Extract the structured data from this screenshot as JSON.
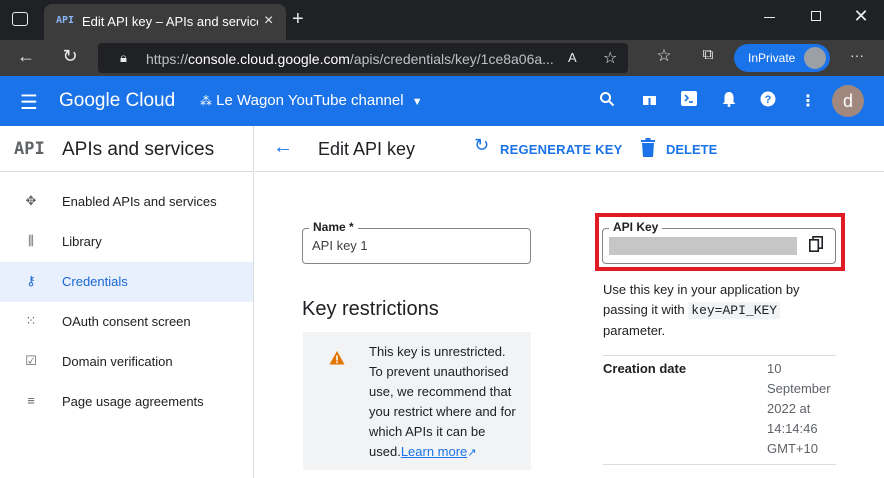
{
  "browser": {
    "tab_icon": "API",
    "tab_title": "Edit API key – APIs and services – ",
    "tab_close": "×",
    "new_tab": "+",
    "url_prefix": "https://",
    "url_host": "console.cloud.google.com",
    "url_path": "/apis/credentials/key/1ce8a06a...",
    "inprivate_label": "InPrivate",
    "more": "···"
  },
  "header": {
    "product": "Google Cloud",
    "project": "Le Wagon YouTube channel",
    "avatar_letter": "d"
  },
  "sidebar": {
    "api_badge": "API",
    "title": "APIs and services",
    "items": [
      {
        "label": "Enabled APIs and services",
        "icon": "hub-icon"
      },
      {
        "label": "Library",
        "icon": "library-icon"
      },
      {
        "label": "Credentials",
        "icon": "key-icon"
      },
      {
        "label": "OAuth consent screen",
        "icon": "consent-icon"
      },
      {
        "label": "Domain verification",
        "icon": "checkbox-icon"
      },
      {
        "label": "Page usage agreements",
        "icon": "settings-list-icon"
      }
    ]
  },
  "toolbar": {
    "title": "Edit API key",
    "regenerate": "REGENERATE KEY",
    "delete": "DELETE"
  },
  "form": {
    "name_label": "Name *",
    "name_value": "API key 1",
    "key_restrictions": "Key restrictions",
    "warning": "This key is unrestricted. To prevent unauthorised use, we recommend that you restrict where and for which APIs it can be used.",
    "learn_more": "Learn more"
  },
  "api_key": {
    "label": "API Key",
    "help_1": "Use this key in your application by passing it with",
    "help_code": "key=API_KEY",
    "help_2": "parameter.",
    "creation_label": "Creation date",
    "creation_value": "10 September 2022 at 14:14:46 GMT+10"
  },
  "colors": {
    "accent": "#1a73e8",
    "highlight_frame": "#e01b24",
    "warning": "#e37400"
  }
}
